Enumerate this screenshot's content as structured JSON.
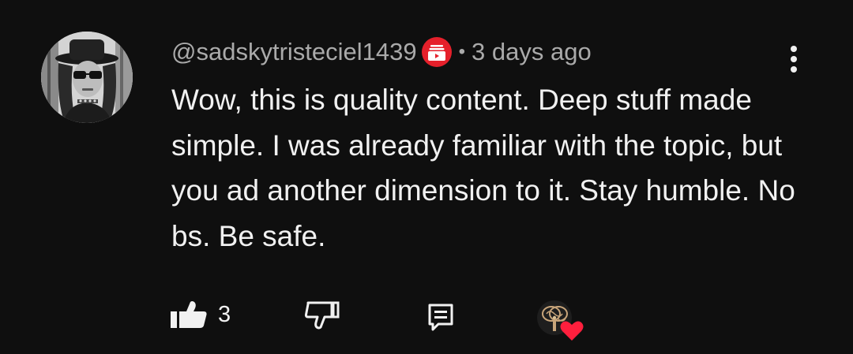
{
  "comment": {
    "author_handle": "@sadskytristeciel1439",
    "separator": "•",
    "timestamp": "3 days ago",
    "text": "Wow, this is quality content. Deep stuff made simple. I was already familiar with the topic, but you ad another dimension to it. Stay humble. No bs. Be safe.",
    "avatar_icon": "user-avatar-photo",
    "badge_icon": "membership-badge-icon"
  },
  "actions": {
    "like_count": "3",
    "like_icon": "thumbs-up-icon",
    "dislike_icon": "thumbs-down-icon",
    "reply_icon": "reply-comment-icon",
    "creator_heart_icon": "creator-heart-icon"
  },
  "menu": {
    "icon": "more-vertical-icon"
  },
  "colors": {
    "background": "#0f0f0f",
    "primary_text": "#f1f1f1",
    "secondary_text": "#aaaaaa",
    "badge_red": "#e5202b",
    "heart_red": "#ff1f3d"
  }
}
